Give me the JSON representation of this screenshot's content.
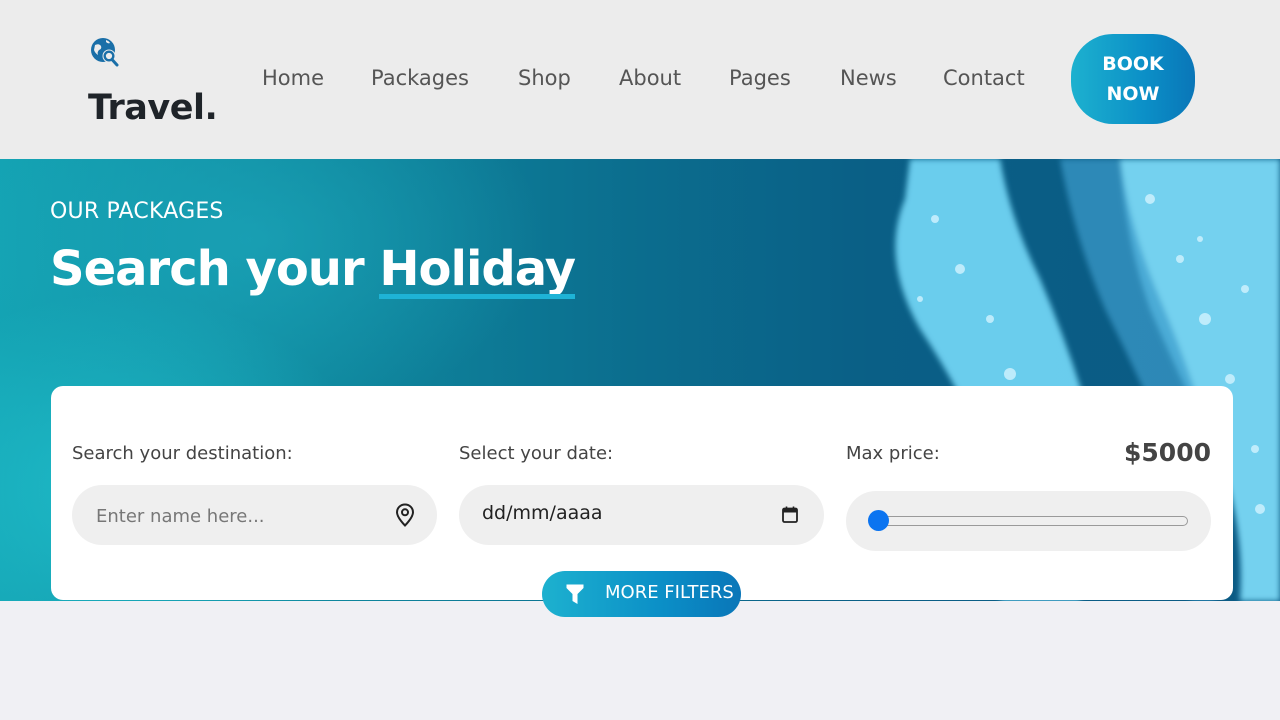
{
  "header": {
    "brand": {
      "name": "Travel.",
      "icon": "globe-search-icon",
      "color": "#1a6fa8"
    },
    "nav": [
      "Home",
      "Packages",
      "Shop",
      "About",
      "Pages",
      "News",
      "Contact"
    ],
    "book_button": {
      "line1": "BOOK",
      "line2": "NOW"
    }
  },
  "hero": {
    "eyebrow": "OUR PACKAGES",
    "title_prefix": "Search your",
    "title_highlight": "Holiday"
  },
  "search": {
    "destination": {
      "label": "Search your destination:",
      "placeholder": "Enter name here...",
      "icon": "map-pin-icon"
    },
    "date": {
      "label": "Select your date:",
      "value": "dd/mm/aaaa",
      "icon": "calendar-icon"
    },
    "price": {
      "label": "Max price:",
      "value": "$5000",
      "slider_fraction": 0.0
    }
  },
  "filters_button": {
    "label": "MORE FILTERS",
    "icon": "filter-icon"
  },
  "colors": {
    "accent": "#0b8fc7",
    "accent_light": "#1db1cf",
    "slider_thumb": "#0b74f0",
    "header_bg": "#ececec"
  }
}
